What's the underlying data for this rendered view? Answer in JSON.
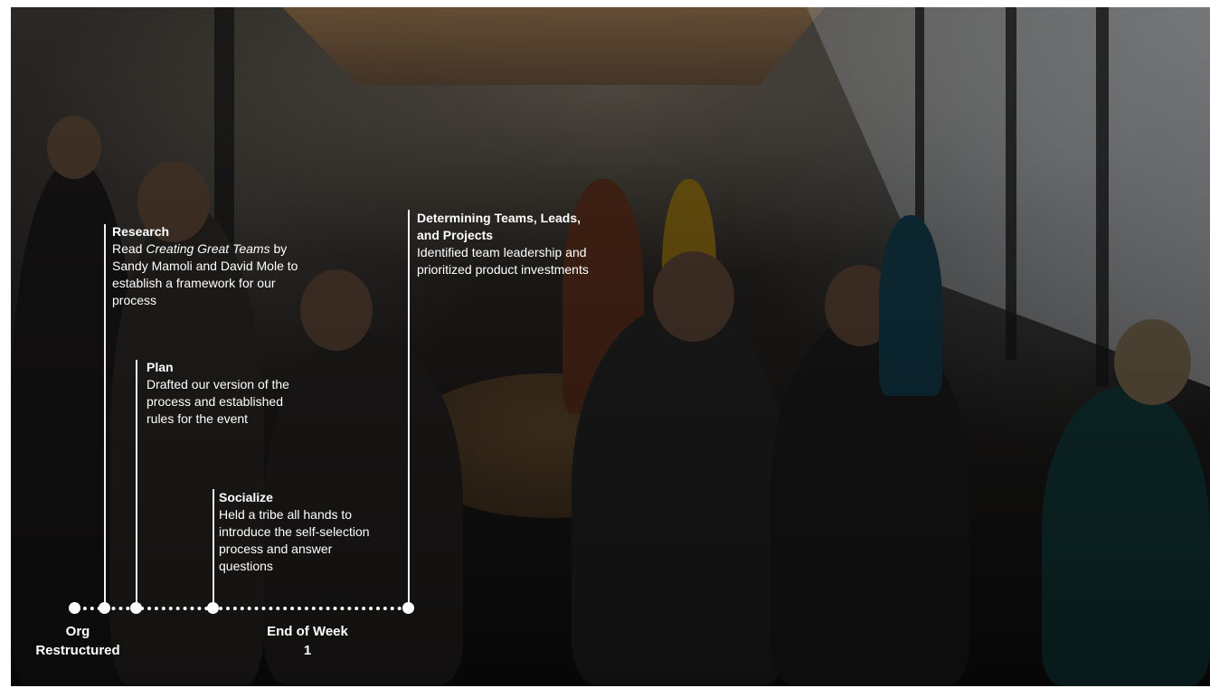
{
  "events": [
    {
      "heading": "Research",
      "body_before_italic": "Read ",
      "body_italic": "Creating Great Teams",
      "body_after_italic": " by Sandy Mamoli and David Mole to establish a framework for our process"
    },
    {
      "heading": "Plan",
      "body": "Drafted our version of the process and established rules for the event"
    },
    {
      "heading": "Socialize",
      "body": "Held a tribe all hands to introduce the self-selection process and answer questions"
    },
    {
      "heading": "Determining Teams, Leads, and Projects",
      "body": "Identified team leadership and prioritized product investments"
    }
  ],
  "axis_labels": {
    "start": "Org Restructured",
    "end": "End of Week 1"
  }
}
